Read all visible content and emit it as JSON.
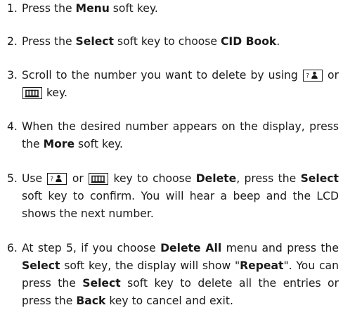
{
  "steps": [
    {
      "number": "1.",
      "parts": [
        {
          "t": "text",
          "v": "Press the "
        },
        {
          "t": "bold",
          "v": "Menu"
        },
        {
          "t": "text",
          "v": " soft key."
        }
      ]
    },
    {
      "number": "2.",
      "parts": [
        {
          "t": "text",
          "v": "Press the "
        },
        {
          "t": "bold",
          "v": "Select"
        },
        {
          "t": "text",
          "v": " soft key to choose "
        },
        {
          "t": "bold",
          "v": "CID Book"
        },
        {
          "t": "text",
          "v": "."
        }
      ]
    },
    {
      "number": "3.",
      "parts": [
        {
          "t": "text",
          "v": "Scroll to the number you want to delete by using "
        },
        {
          "t": "icon",
          "v": "contact-key-icon"
        },
        {
          "t": "text",
          "v": " or "
        },
        {
          "t": "icon",
          "v": "book-key-icon"
        },
        {
          "t": "text",
          "v": " key."
        }
      ]
    },
    {
      "number": "4.",
      "parts": [
        {
          "t": "text",
          "v": "When the desired number appears on the display, press the "
        },
        {
          "t": "bold",
          "v": "More"
        },
        {
          "t": "text",
          "v": " soft key."
        }
      ]
    },
    {
      "number": "5.",
      "parts": [
        {
          "t": "text",
          "v": "Use "
        },
        {
          "t": "icon",
          "v": "contact-key-icon"
        },
        {
          "t": "text",
          "v": " or "
        },
        {
          "t": "icon",
          "v": "book-key-icon"
        },
        {
          "t": "text",
          "v": " key to choose "
        },
        {
          "t": "bold",
          "v": "Delete"
        },
        {
          "t": "text",
          "v": ", press the "
        },
        {
          "t": "bold",
          "v": "Select"
        },
        {
          "t": "text",
          "v": " soft key to confirm. You will hear a beep and the LCD shows the next number."
        }
      ]
    },
    {
      "number": "6.",
      "parts": [
        {
          "t": "text",
          "v": "At step 5, if you choose "
        },
        {
          "t": "bold",
          "v": "Delete All"
        },
        {
          "t": "text",
          "v": " menu and press the "
        },
        {
          "t": "bold",
          "v": "Select"
        },
        {
          "t": "text",
          "v": " soft key, the display will show \""
        },
        {
          "t": "bold",
          "v": "Repeat"
        },
        {
          "t": "text",
          "v": "\". You can press the "
        },
        {
          "t": "bold",
          "v": "Select"
        },
        {
          "t": "text",
          "v": " soft key to delete all the entries or press the "
        },
        {
          "t": "bold",
          "v": "Back"
        },
        {
          "t": "text",
          "v": " key to cancel and exit."
        }
      ]
    }
  ]
}
